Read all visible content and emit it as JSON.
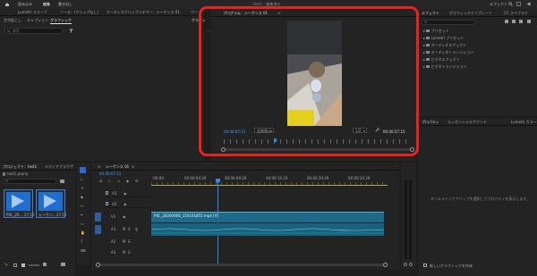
{
  "app": {
    "menu": [
      "読み込み",
      "編集",
      "書き出し"
    ],
    "doc_title": "test1 - 編集済み",
    "workspace_right": "エフェクト",
    "title_icons": [
      "search-icon",
      "fullscreen-icon",
      "share-icon"
    ]
  },
  "top_left": {
    "tabs_row1": [
      "Lumetri スコープ",
      "ソース：(クリップなし)",
      "オーディオクリップミキサー：シーケンス 01",
      "ワー"
    ],
    "tabs_row2": [
      "文字起こし",
      "キャプション",
      "グラフィック"
    ],
    "side_tab": "グラフィ",
    "search_placeholder": "検索",
    "more": "…"
  },
  "program": {
    "title": "プログラム：シーケンス 01",
    "timecode": "00:00:07:21",
    "fit": "全体表示",
    "quality": "1/2",
    "duration": "00:00:27:15"
  },
  "effects": {
    "tabs": [
      "エフェクト",
      "グラフィックテンプレート",
      "CC ライブラリ"
    ],
    "items": [
      "プリセット",
      "Lumetri プリセット",
      "オーディオエフェクト",
      "オーディオトランジション",
      "ビデオエフェクト",
      "ビデオトランジション"
    ]
  },
  "properties": {
    "tabs": [
      "プロパティ",
      "エッセンシャルサウンド",
      "Lumetri カラー"
    ],
    "hint": "タイムラインでクリップを選択してプロパティを表示します。",
    "new_layer": "新しいグラフィックを作成"
  },
  "project": {
    "tabs": [
      "プロジェクト：test1",
      "メディアブラウザ"
    ],
    "file": "test1.prproj",
    "thumbs": [
      {
        "name": "PXL_20...",
        "duration": "27:15"
      },
      {
        "name": "シーケン...",
        "duration": "27:15"
      }
    ]
  },
  "timeline": {
    "title": "シーケンス 01",
    "timecode": "00:00:07:21",
    "ruler": [
      ":00:00",
      "00:00:04:29",
      "00:00:09:29",
      "00:00:14:29",
      "00:00:19:29",
      "00:00:24:29"
    ],
    "video_tracks": [
      "V3",
      "V2",
      "V1"
    ],
    "audio_tracks": [
      "A1",
      "A2",
      "A3"
    ],
    "clip_name": "PXL_20200906_150101855.mp4 [V]",
    "track_btns": [
      "M",
      "S"
    ]
  },
  "annotation": {
    "color": "#e8231f"
  }
}
